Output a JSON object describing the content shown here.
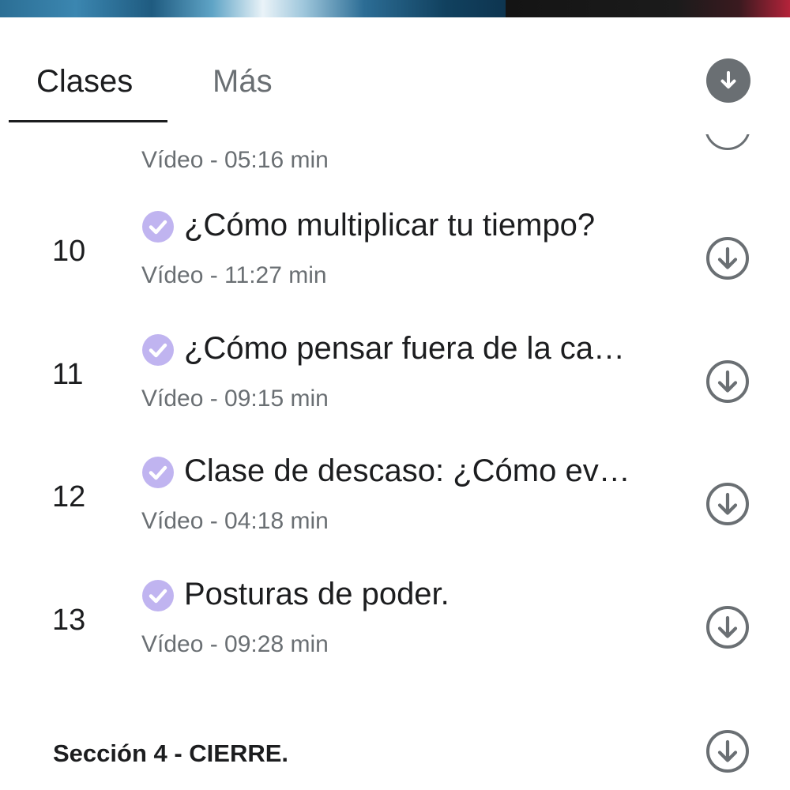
{
  "tabs": [
    {
      "label": "Clases",
      "active": true
    },
    {
      "label": "Más",
      "active": false
    }
  ],
  "icons": {
    "download_all": "download-circle-filled-icon",
    "lesson_download": "download-circle-outline-icon",
    "completed": "check-circle-icon"
  },
  "colors": {
    "text_primary": "#1c1d1f",
    "text_secondary": "#6a6f73",
    "check_accent": "#c0b4f0"
  },
  "partial_lesson": {
    "meta": "Vídeo - 05:16 min"
  },
  "lessons": [
    {
      "number": "10",
      "title": "¿Cómo multiplicar tu tiempo?",
      "meta": "Vídeo - 11:27 min",
      "completed": true
    },
    {
      "number": "11",
      "title": "¿Cómo pensar fuera de la ca…",
      "meta": "Vídeo - 09:15 min",
      "completed": true
    },
    {
      "number": "12",
      "title": "Clase de descaso: ¿Cómo ev…",
      "meta": "Vídeo - 04:18 min",
      "completed": true
    },
    {
      "number": "13",
      "title": "Posturas de poder.",
      "meta": "Vídeo - 09:28 min",
      "completed": true
    }
  ],
  "section": {
    "title": "Sección 4 - CIERRE."
  }
}
